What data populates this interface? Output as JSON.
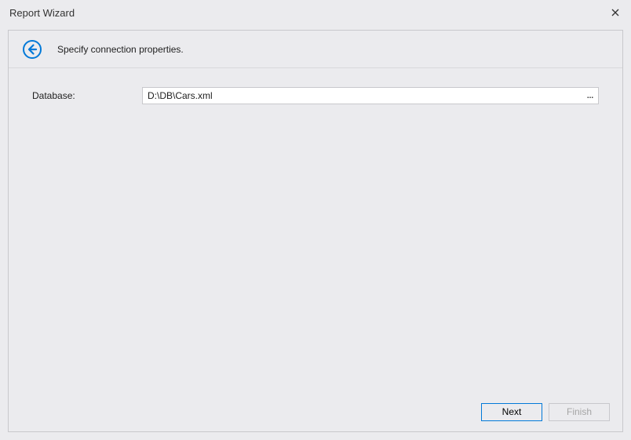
{
  "window": {
    "title": "Report Wizard"
  },
  "header": {
    "subtitle": "Specify connection properties."
  },
  "form": {
    "database_label": "Database:",
    "database_value": "D:\\DB\\Cars.xml",
    "ellipsis": "..."
  },
  "footer": {
    "next_label": "Next",
    "finish_label": "Finish"
  }
}
